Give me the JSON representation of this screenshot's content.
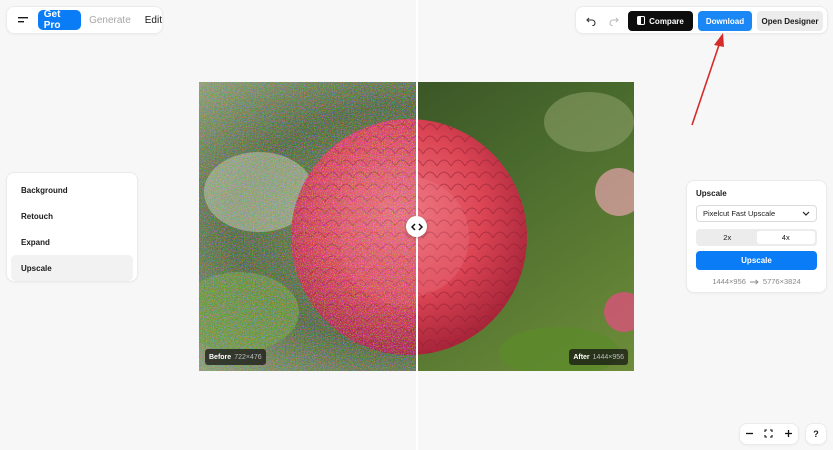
{
  "topbar": {
    "get_pro": "Get Pro",
    "generate": "Generate",
    "edit": "Edit",
    "compare": "Compare",
    "download": "Download",
    "open_designer": "Open Designer"
  },
  "image": {
    "before_label": "Before",
    "before_dims": "722×476",
    "after_label": "After",
    "after_dims": "1444×956"
  },
  "tools": {
    "items": [
      "Background",
      "Retouch",
      "Expand",
      "Upscale"
    ],
    "active": "Upscale"
  },
  "upscale_panel": {
    "title": "Upscale",
    "model": "Pixelcut Fast Upscale",
    "scale_options": [
      "2x",
      "4x"
    ],
    "selected_scale": "4x",
    "button": "Upscale",
    "from_res": "1444×956",
    "to_res": "5776×3824"
  },
  "controls": {
    "help": "?"
  },
  "colors": {
    "accent": "#0a7cf5",
    "download": "#1a87f5",
    "annotation_arrow": "#d62b2b"
  }
}
